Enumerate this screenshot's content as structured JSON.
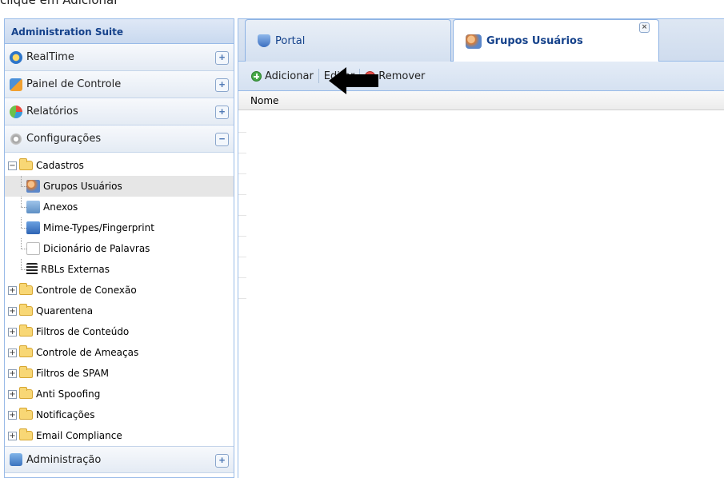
{
  "caption": "clique em Adicionar",
  "admin": {
    "title": "Administration Suite",
    "sections": [
      {
        "label": "RealTime",
        "toggle": "+",
        "icon": "realtime-clock-icon"
      },
      {
        "label": "Painel de Controle",
        "toggle": "+",
        "icon": "control-panel-icon"
      },
      {
        "label": "Relatórios",
        "toggle": "+",
        "icon": "reports-pie-icon"
      },
      {
        "label": "Configurações",
        "toggle": "−",
        "icon": "settings-gears-icon"
      }
    ],
    "tree": {
      "root": "Cadastros",
      "children": [
        {
          "label": "Grupos Usuários",
          "icon": "user-groups-icon",
          "selected": true
        },
        {
          "label": "Anexos",
          "icon": "attachments-icon"
        },
        {
          "label": "Mime-Types/Fingerprint",
          "icon": "mime-types-icon"
        },
        {
          "label": "Dicionário de Palavras",
          "icon": "dictionary-icon"
        },
        {
          "label": "RBLs Externas",
          "icon": "rbl-list-icon"
        }
      ],
      "folders": [
        "Controle de Conexão",
        "Quarentena",
        "Filtros de Conteúdo",
        "Controle de Ameaças",
        "Filtros de SPAM",
        "Anti Spoofing",
        "Notificações",
        "Email Compliance"
      ]
    },
    "bottom_section": {
      "label": "Administração",
      "toggle": "+",
      "icon": "administration-icon"
    }
  },
  "tabs": [
    {
      "label": "Portal",
      "icon": "portal-shield-icon",
      "active": false
    },
    {
      "label": "Grupos Usuários",
      "icon": "user-groups-icon",
      "active": true,
      "close": "×"
    }
  ],
  "toolbar": {
    "add_label": "Adicionar",
    "edit_label": "Editar",
    "remove_label": "Remover"
  },
  "grid": {
    "column": "Nome"
  },
  "colors": {
    "header_text": "#15428b",
    "panel_border": "#99bbe8",
    "add_green": "#46a948",
    "remove_red": "#e4504a"
  }
}
